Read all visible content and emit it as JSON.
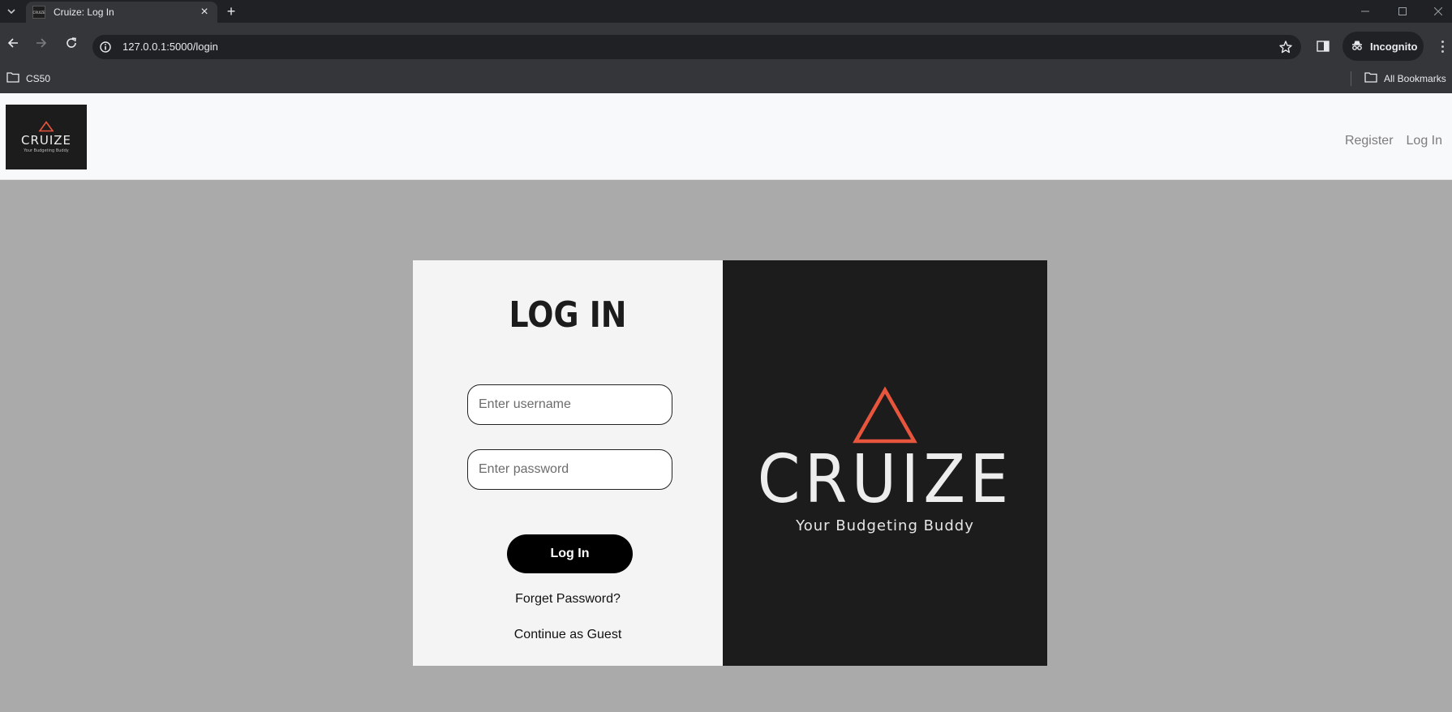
{
  "browser": {
    "tab_title": "Cruize: Log In",
    "tab_favicon_text": "CRUIZE",
    "url": "127.0.0.1:5000/login",
    "incognito_label": "Incognito",
    "bookmarks": [
      {
        "label": "CS50",
        "icon": "folder-icon"
      }
    ],
    "all_bookmarks_label": "All Bookmarks"
  },
  "navbar": {
    "brand": {
      "wordmark": "CRUIZE",
      "tagline": "Your Budgeting Buddy"
    },
    "links": [
      {
        "label": "Register"
      },
      {
        "label": "Log In"
      }
    ]
  },
  "login": {
    "title": "LOG IN",
    "username_placeholder": "Enter username",
    "username_value": "",
    "password_placeholder": "Enter password",
    "password_value": "",
    "submit_label": "Log In",
    "forgot_label": "Forget Password?",
    "guest_label": "Continue as Guest"
  },
  "hero": {
    "wordmark": "CRUIZE",
    "tagline": "Your Budgeting Buddy"
  },
  "colors": {
    "accent": "#e8553d",
    "panel_dark": "#1c1c1c",
    "page_bg": "#aaaaaa",
    "button_bg": "#000000"
  }
}
